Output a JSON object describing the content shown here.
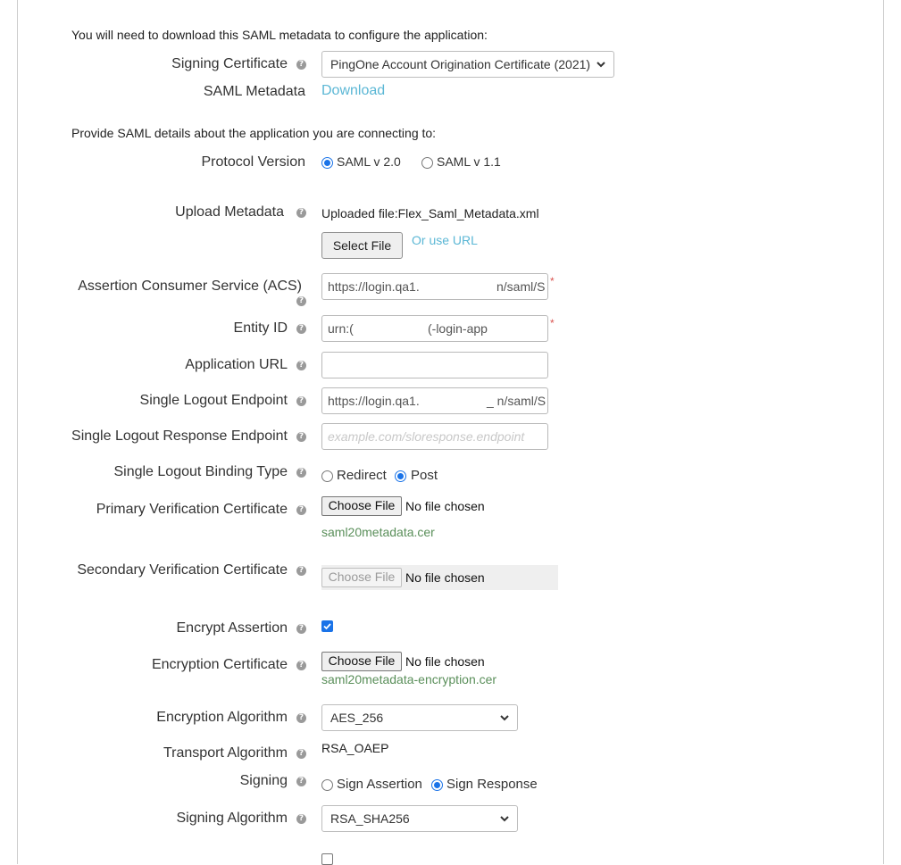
{
  "intro_download": "You will need to download this SAML metadata to configure the application:",
  "signing_certificate": {
    "label": "Signing Certificate",
    "value": "PingOne Account Origination Certificate (2021)"
  },
  "saml_metadata": {
    "label": "SAML Metadata",
    "link": "Download"
  },
  "intro_details": "Provide SAML details about the application you are connecting to:",
  "protocol_version": {
    "label": "Protocol Version",
    "option1": "SAML v 2.0",
    "option2": "SAML v 1.1",
    "selected": "SAML v 2.0"
  },
  "upload_metadata": {
    "label": "Upload Metadata",
    "status": "Uploaded file:Flex_Saml_Metadata.xml",
    "select_button": "Select File",
    "url_link": "Or use URL"
  },
  "acs": {
    "label": "Assertion Consumer Service (ACS)",
    "value_start": "https://login.qa1.",
    "value_end": "n/saml/S",
    "required": "*"
  },
  "entity_id": {
    "label": "Entity ID",
    "value_start": "urn:(",
    "value_end": "(-login-app",
    "required": "*"
  },
  "application_url": {
    "label": "Application URL",
    "value": ""
  },
  "slo_endpoint": {
    "label": "Single Logout Endpoint",
    "value_start": "https://login.qa1.",
    "value_end": "_ n/saml/S"
  },
  "slo_response_endpoint": {
    "label": "Single Logout Response Endpoint",
    "placeholder": "example.com/sloresponse.endpoint"
  },
  "slo_binding_type": {
    "label": "Single Logout Binding Type",
    "option1": "Redirect",
    "option2": "Post",
    "selected": "Post"
  },
  "primary_cert": {
    "label": "Primary Verification Certificate",
    "button": "Choose File",
    "status": "No file chosen",
    "filename": "saml20metadata.cer"
  },
  "secondary_cert": {
    "label": "Secondary Verification Certificate",
    "button": "Choose File",
    "status": "No file chosen"
  },
  "encrypt_assertion": {
    "label": "Encrypt Assertion",
    "checked": true
  },
  "encryption_cert": {
    "label": "Encryption Certificate",
    "button": "Choose File",
    "status": "No file chosen",
    "filename": "saml20metadata-encryption.cer"
  },
  "encryption_algorithm": {
    "label": "Encryption Algorithm",
    "value": "AES_256"
  },
  "transport_algorithm": {
    "label": "Transport Algorithm",
    "value": "RSA_OAEP"
  },
  "signing": {
    "label": "Signing",
    "option1": "Sign Assertion",
    "option2": "Sign Response",
    "selected": "Sign Response"
  },
  "signing_algorithm": {
    "label": "Signing Algorithm",
    "value": "RSA_SHA256"
  },
  "help_glyph": "?",
  "icons": {
    "help": "question-circle-icon",
    "dropdown": "chevron-down-icon"
  },
  "colors": {
    "link": "#5bb7d5",
    "accent": "#1a73e8",
    "filename": "#5a8f5a",
    "required": "#d9534f"
  }
}
